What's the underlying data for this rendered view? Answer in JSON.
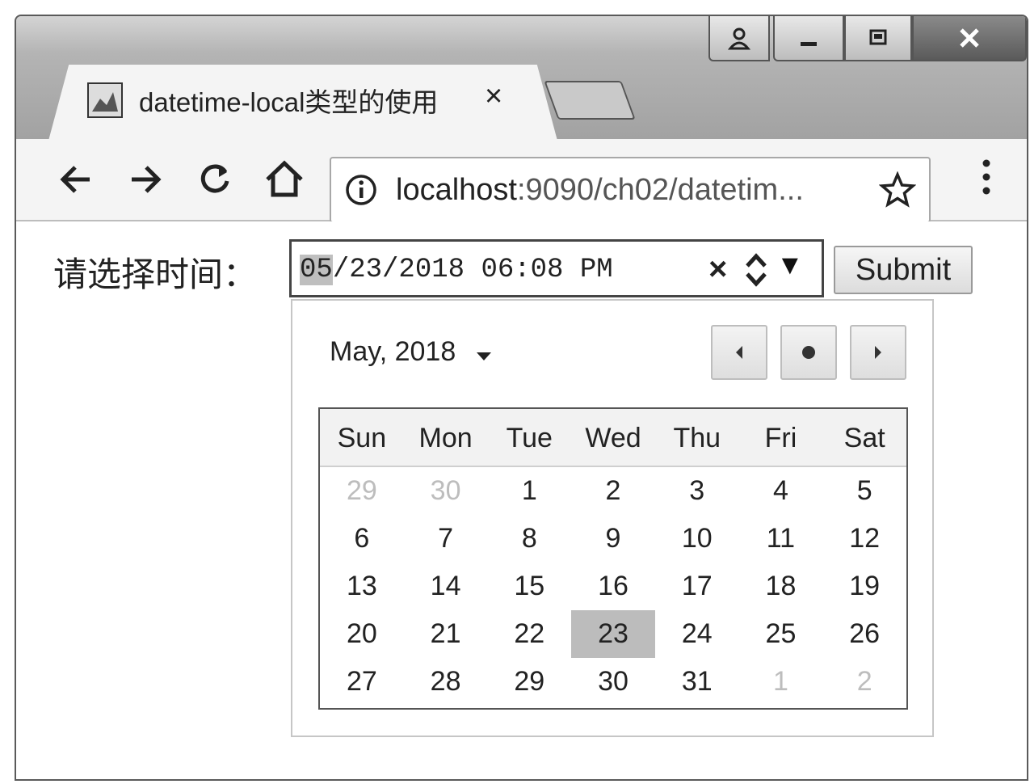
{
  "browser": {
    "tab_title": "datetime-local类型的使用",
    "tab_close": "×",
    "url_host": "localhost",
    "url_rest": ":9090/ch02/datetim..."
  },
  "page": {
    "label": "请选择时间：",
    "datetime": {
      "month": "05",
      "rest": "/23/2018 06:08 PM",
      "clear": "×",
      "dropdown": "▼"
    },
    "submit_label": "Submit"
  },
  "picker": {
    "month_label": "May, 2018",
    "weekdays": [
      "Sun",
      "Mon",
      "Tue",
      "Wed",
      "Thu",
      "Fri",
      "Sat"
    ],
    "weeks": [
      [
        {
          "d": "29",
          "other": true
        },
        {
          "d": "30",
          "other": true
        },
        {
          "d": "1"
        },
        {
          "d": "2"
        },
        {
          "d": "3"
        },
        {
          "d": "4"
        },
        {
          "d": "5"
        }
      ],
      [
        {
          "d": "6"
        },
        {
          "d": "7"
        },
        {
          "d": "8"
        },
        {
          "d": "9"
        },
        {
          "d": "10"
        },
        {
          "d": "11"
        },
        {
          "d": "12"
        }
      ],
      [
        {
          "d": "13"
        },
        {
          "d": "14"
        },
        {
          "d": "15"
        },
        {
          "d": "16"
        },
        {
          "d": "17"
        },
        {
          "d": "18"
        },
        {
          "d": "19"
        }
      ],
      [
        {
          "d": "20"
        },
        {
          "d": "21"
        },
        {
          "d": "22"
        },
        {
          "d": "23",
          "selected": true
        },
        {
          "d": "24"
        },
        {
          "d": "25"
        },
        {
          "d": "26"
        }
      ],
      [
        {
          "d": "27"
        },
        {
          "d": "28"
        },
        {
          "d": "29"
        },
        {
          "d": "30"
        },
        {
          "d": "31"
        },
        {
          "d": "1",
          "other": true
        },
        {
          "d": "2",
          "other": true
        }
      ]
    ]
  },
  "icons": {
    "back": "back-arrow-icon",
    "forward": "forward-arrow-icon",
    "reload": "reload-icon",
    "home": "home-icon",
    "info": "info-icon",
    "star": "bookmark-star-icon",
    "menu": "more-vertical-icon"
  },
  "colors": {
    "selected_day_bg": "#bcbcbc",
    "other_month_day": "#bdbdbd"
  }
}
